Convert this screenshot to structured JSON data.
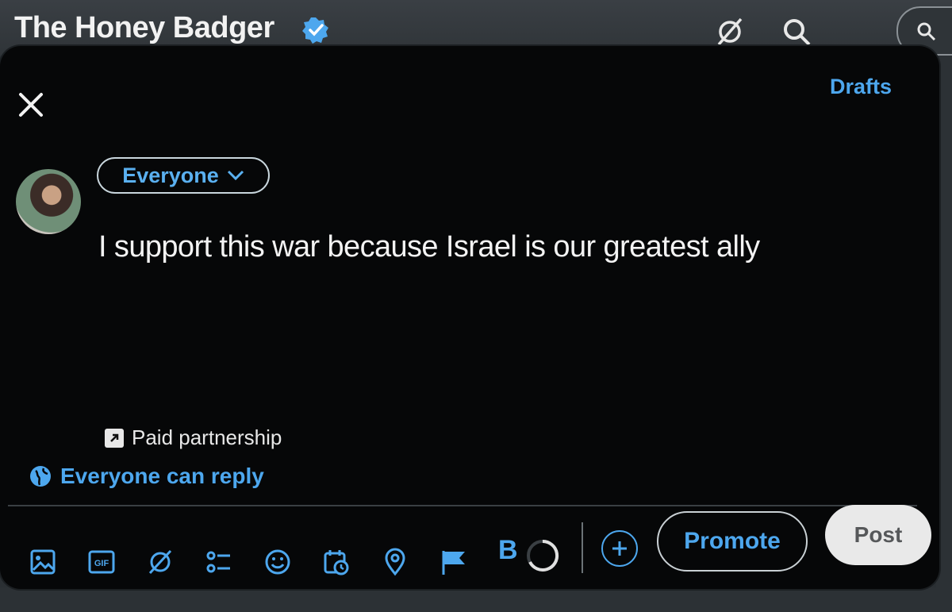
{
  "header": {
    "title": "The Honey Badger",
    "verified_icon": "verified-badge-icon",
    "icons": [
      "grok-icon",
      "search-icon"
    ]
  },
  "composer": {
    "drafts_label": "Drafts",
    "audience_label": "Everyone",
    "text": "I support this war because Israel is our greatest ally",
    "paid_partnership_label": "Paid partnership",
    "reply_setting_label": "Everyone can reply",
    "toolbar": {
      "icons": [
        "image-icon",
        "gif-icon",
        "grok-icon",
        "poll-icon",
        "emoji-icon",
        "schedule-icon",
        "location-icon",
        "flag-icon"
      ],
      "bold_label": "B",
      "promote_label": "Promote",
      "post_label": "Post"
    }
  },
  "colors": {
    "accent": "#4da7ee",
    "modal_bg": "#060708",
    "post_button_bg": "#e9e9e9"
  }
}
